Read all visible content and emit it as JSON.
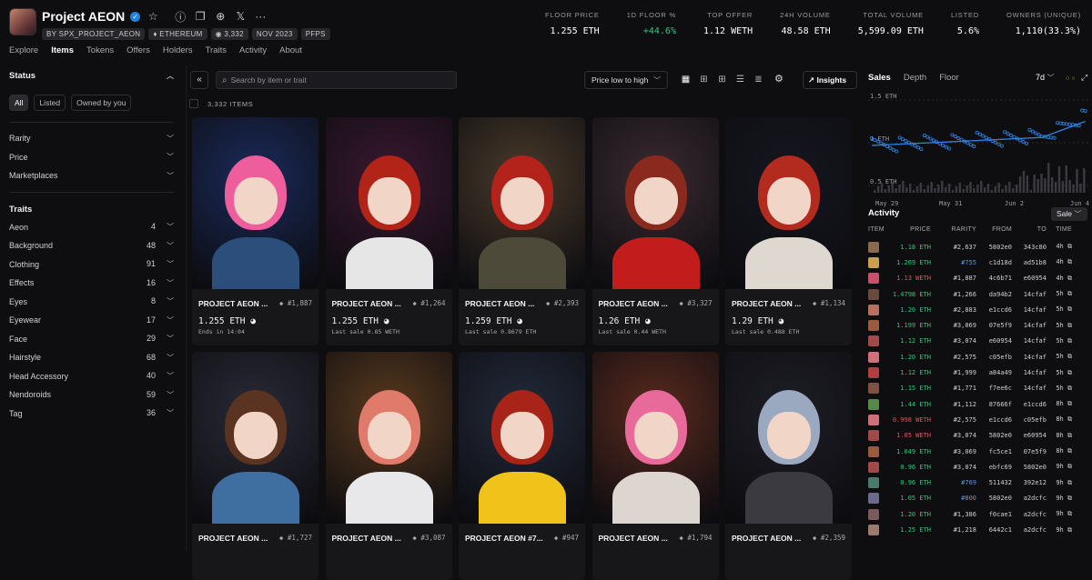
{
  "header": {
    "title": "Project AEON",
    "creator": "BY SPX_PROJECT_AEON",
    "chain": "ETHEREUM",
    "items_count": "3,332",
    "date": "NOV 2023",
    "category": "PFPS",
    "stats": [
      {
        "label": "FLOOR PRICE",
        "value": "1.255 ETH",
        "color": "white"
      },
      {
        "label": "1D FLOOR %",
        "value": "+44.6%",
        "color": "green"
      },
      {
        "label": "TOP OFFER",
        "value": "1.12 WETH",
        "color": "white"
      },
      {
        "label": "24H VOLUME",
        "value": "48.58 ETH",
        "color": "white"
      },
      {
        "label": "TOTAL VOLUME",
        "value": "5,599.09 ETH",
        "color": "white"
      },
      {
        "label": "LISTED",
        "value": "5.6%",
        "color": "white"
      },
      {
        "label": "OWNERS (UNIQUE)",
        "value": "1,110(33.3%)",
        "color": "white"
      }
    ]
  },
  "tabs": [
    "Explore",
    "Items",
    "Tokens",
    "Offers",
    "Holders",
    "Traits",
    "Activity",
    "About"
  ],
  "sidebar": {
    "status_title": "Status",
    "status_buttons": [
      "All",
      "Listed",
      "Owned by you"
    ],
    "filters": [
      "Rarity",
      "Price",
      "Marketplaces"
    ],
    "traits_title": "Traits",
    "traits": [
      {
        "name": "Aeon",
        "count": "4"
      },
      {
        "name": "Background",
        "count": "48"
      },
      {
        "name": "Clothing",
        "count": "91"
      },
      {
        "name": "Effects",
        "count": "16"
      },
      {
        "name": "Eyes",
        "count": "8"
      },
      {
        "name": "Eyewear",
        "count": "17"
      },
      {
        "name": "Face",
        "count": "29"
      },
      {
        "name": "Hairstyle",
        "count": "68"
      },
      {
        "name": "Head Accessory",
        "count": "40"
      },
      {
        "name": "Nendoroids",
        "count": "59"
      },
      {
        "name": "Tag",
        "count": "36"
      }
    ]
  },
  "toolbar": {
    "search_placeholder": "Search by item or trait",
    "sort_label": "Price low to high",
    "insights_label": "Insights",
    "items_count_label": "3,332 ITEMS"
  },
  "cards": [
    {
      "name": "PROJECT AEON ...",
      "rank": "#1,887",
      "price": "1.255 ETH",
      "sub": "Ends in 14:04",
      "bg": "#1a2a5a",
      "hair": "#ee5e9c",
      "shirt": "#2b4e7a"
    },
    {
      "name": "PROJECT AEON ...",
      "rank": "#1,264",
      "price": "1.255 ETH",
      "sub": "Last sale 0.85 WETH",
      "bg": "#3a1830",
      "hair": "#b32418",
      "shirt": "#e6e6e6"
    },
    {
      "name": "PROJECT AEON ...",
      "rank": "#2,393",
      "price": "1.259 ETH",
      "sub": "Last sale 0.8679 ETH",
      "bg": "#4a3a2a",
      "hair": "#b3231c",
      "shirt": "#4d4a3a"
    },
    {
      "name": "PROJECT AEON ...",
      "rank": "#3,327",
      "price": "1.26 ETH",
      "sub": "Last sale 0.44 WETH",
      "bg": "#3a2a30",
      "hair": "#8a2a1e",
      "shirt": "#c21c1c"
    },
    {
      "name": "PROJECT AEON ...",
      "rank": "#1,134",
      "price": "1.29 ETH",
      "sub": "Last sale 0.488 ETH",
      "bg": "#161620",
      "hair": "#b32a1e",
      "shirt": "#ded8d0"
    },
    {
      "name": "PROJECT AEON ...",
      "rank": "#1,727",
      "price": "",
      "sub": "",
      "bg": "#2a2a38",
      "hair": "#5a3420",
      "shirt": "#3f6fa0"
    },
    {
      "name": "PROJECT AEON ...",
      "rank": "#3,087",
      "price": "",
      "sub": "",
      "bg": "#5a3a1e",
      "hair": "#e07a6a",
      "shirt": "#e8e8ea"
    },
    {
      "name": "PROJECT AEON #7...",
      "rank": "#947",
      "price": "",
      "sub": "",
      "bg": "#222a3a",
      "hair": "#a82418",
      "shirt": "#f0c21a"
    },
    {
      "name": "PROJECT AEON ...",
      "rank": "#1,794",
      "price": "",
      "sub": "",
      "bg": "#5a2a1e",
      "hair": "#e86a9a",
      "shirt": "#ddd5d0"
    },
    {
      "name": "PROJECT AEON ...",
      "rank": "#2,359",
      "price": "",
      "sub": "",
      "bg": "#1e1e26",
      "hair": "#9aa8c0",
      "shirt": "#3a3a40"
    }
  ],
  "right": {
    "tabs": [
      "Sales",
      "Depth",
      "Floor"
    ],
    "range": "7d",
    "chart_y_labels": [
      "1.5 ETH",
      "1 ETH",
      "0.5 ETH"
    ],
    "chart_x_labels": [
      "May 29",
      "May 31",
      "Jun 2",
      "Jun 4"
    ],
    "activity_title": "Activity",
    "activity_filter": "Sale",
    "columns": [
      "ITEM",
      "PRICE",
      "RARITY",
      "FROM",
      "TO",
      "TIME"
    ],
    "rows": [
      {
        "price": "1.18 ETH",
        "pc": "green",
        "rarity": "#2,637",
        "rc": "n",
        "from": "5802e0",
        "to": "343c80",
        "time": "4h",
        "thumb": "#8a6a4a"
      },
      {
        "price": "1.269 ETH",
        "pc": "green",
        "rarity": "#755",
        "rc": "blue",
        "from": "c1d18d",
        "to": "ad51b8",
        "time": "4h",
        "thumb": "#c8a050"
      },
      {
        "price": "1.13 WETH",
        "pc": "red",
        "rarity": "#1,887",
        "rc": "n",
        "from": "4c6b71",
        "to": "e60954",
        "time": "4h",
        "thumb": "#c8506a"
      },
      {
        "price": "1.4798 ETH",
        "pc": "green",
        "rarity": "#1,266",
        "rc": "n",
        "from": "da94b2",
        "to": "14cfaf",
        "time": "5h",
        "thumb": "#6a4a3a"
      },
      {
        "price": "1.20 ETH",
        "pc": "green",
        "rarity": "#2,883",
        "rc": "n",
        "from": "e1ccd6",
        "to": "14cfaf",
        "time": "5h",
        "thumb": "#b87060"
      },
      {
        "price": "1.199 ETH",
        "pc": "green",
        "rarity": "#3,069",
        "rc": "n",
        "from": "07e5f9",
        "to": "14cfaf",
        "time": "5h",
        "thumb": "#9a5a40"
      },
      {
        "price": "1.12 ETH",
        "pc": "green",
        "rarity": "#3,074",
        "rc": "n",
        "from": "e60954",
        "to": "14cfaf",
        "time": "5h",
        "thumb": "#a04a4a"
      },
      {
        "price": "1.20 ETH",
        "pc": "green",
        "rarity": "#2,575",
        "rc": "n",
        "from": "c05efb",
        "to": "14cfaf",
        "time": "5h",
        "thumb": "#d0707a"
      },
      {
        "price": "1.12 ETH",
        "pc": "green",
        "rarity": "#1,999",
        "rc": "n",
        "from": "a84a49",
        "to": "14cfaf",
        "time": "5h",
        "thumb": "#b04040"
      },
      {
        "price": "1.15 ETH",
        "pc": "green",
        "rarity": "#1,771",
        "rc": "n",
        "from": "f7ee6c",
        "to": "14cfaf",
        "time": "5h",
        "thumb": "#805040"
      },
      {
        "price": "1.44 ETH",
        "pc": "green",
        "rarity": "#1,112",
        "rc": "n",
        "from": "87666f",
        "to": "e1ccd6",
        "time": "8h",
        "thumb": "#5a8a4a"
      },
      {
        "price": "0.998 WETH",
        "pc": "red",
        "rarity": "#2,575",
        "rc": "n",
        "from": "e1ccd6",
        "to": "c05efb",
        "time": "8h",
        "thumb": "#d0707a"
      },
      {
        "price": "1.05 WETH",
        "pc": "red",
        "rarity": "#3,074",
        "rc": "n",
        "from": "5802e0",
        "to": "e60954",
        "time": "8h",
        "thumb": "#a04a4a"
      },
      {
        "price": "1.049 ETH",
        "pc": "green",
        "rarity": "#3,069",
        "rc": "n",
        "from": "fc5ce1",
        "to": "07e5f9",
        "time": "8h",
        "thumb": "#9a5a40"
      },
      {
        "price": "0.96 ETH",
        "pc": "green",
        "rarity": "#3,074",
        "rc": "n",
        "from": "ebfc69",
        "to": "5802e0",
        "time": "9h",
        "thumb": "#a04a4a"
      },
      {
        "price": "0.96 ETH",
        "pc": "green",
        "rarity": "#769",
        "rc": "blue",
        "from": "511432",
        "to": "392e12",
        "time": "9h",
        "thumb": "#4a7a6a"
      },
      {
        "price": "1.05 ETH",
        "pc": "green",
        "rarity": "#800",
        "rc": "blue",
        "from": "5802e0",
        "to": "a2dcfc",
        "time": "9h",
        "thumb": "#6a6a8a"
      },
      {
        "price": "1.20 ETH",
        "pc": "green",
        "rarity": "#1,386",
        "rc": "n",
        "from": "f0cae1",
        "to": "a2dcfc",
        "time": "9h",
        "thumb": "#7a5a5a"
      },
      {
        "price": "1.25 ETH",
        "pc": "green",
        "rarity": "#1,218",
        "rc": "n",
        "from": "6442c1",
        "to": "a2dcfc",
        "time": "9h",
        "thumb": "#9a7a6a"
      }
    ]
  },
  "colors": {
    "accent": "#2081e2",
    "green": "#34c77b",
    "red": "#eb4d5b",
    "blue": "#4d9bf5"
  }
}
